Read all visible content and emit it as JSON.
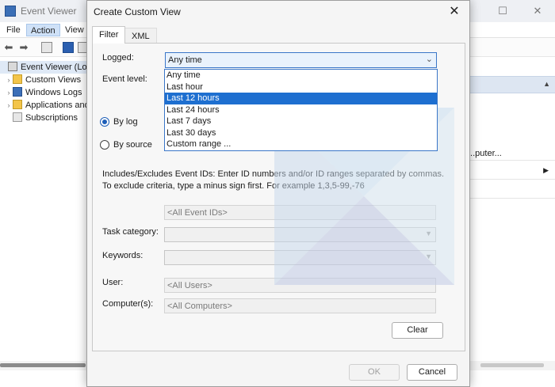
{
  "ev": {
    "title": "Event Viewer",
    "menu": [
      "File",
      "Action",
      "View"
    ],
    "tree": [
      "Event Viewer (Local)",
      "Custom Views",
      "Windows Logs",
      "Applications and Services Logs",
      "Subscriptions"
    ],
    "right_pane": {
      "item_text": "...puter..."
    }
  },
  "dialog": {
    "title": "Create Custom View",
    "tabs": [
      "Filter",
      "XML"
    ],
    "logged_label": "Logged:",
    "logged_value": "Any time",
    "logged_options": [
      "Any time",
      "Last hour",
      "Last 12 hours",
      "Last 24 hours",
      "Last 7 days",
      "Last 30 days",
      "Custom range ..."
    ],
    "selected_option": "Last 12 hours",
    "event_level_label": "Event level:",
    "by_log_label": "By log",
    "by_source_label": "By source",
    "ids_text": "Includes/Excludes Event IDs: Enter ID numbers and/or ID ranges separated by commas. To exclude criteria, type a minus sign first. For example 1,3,5-99,-76",
    "event_ids_placeholder": "<All Event IDs>",
    "task_category_label": "Task category:",
    "keywords_label": "Keywords:",
    "user_label": "User:",
    "user_placeholder": "<All Users>",
    "computer_label": "Computer(s):",
    "computer_placeholder": "<All Computers>",
    "clear_label": "Clear",
    "ok_label": "OK",
    "cancel_label": "Cancel"
  },
  "colors": {
    "accent": "#1e6fd0",
    "selection_bg": "#1e6fd0",
    "dropdown_border": "#3a76c8",
    "watermark_light": "#c8dff0",
    "watermark_dark": "#c5cde6"
  },
  "icons": [
    "back-arrow-icon",
    "forward-arrow-icon",
    "help-icon",
    "close-icon",
    "chevron-down-icon",
    "minimize-icon",
    "maximize-icon"
  ]
}
